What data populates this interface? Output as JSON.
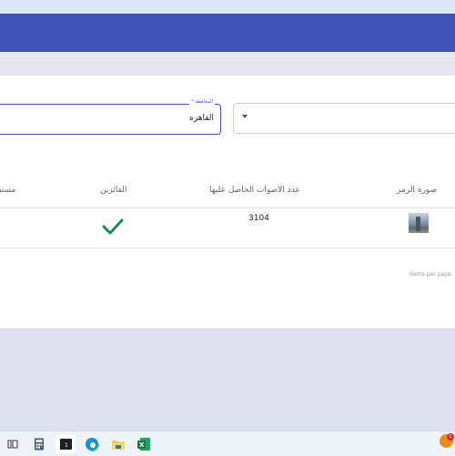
{
  "filters": {
    "select": {
      "value": ""
    },
    "governorate": {
      "label": "المحافظة",
      "required_mark": "*",
      "value": "القاهره"
    }
  },
  "table": {
    "columns": [
      "صورة الرمز",
      "عدد الاصوات الحاصل عليها",
      "الفائزين",
      "مستبعد"
    ],
    "rows": [
      {
        "thumbnail_icon": "landmark-tower-thumbnail",
        "votes": "3104",
        "winner_icon": "check-icon",
        "excluded": ""
      }
    ]
  },
  "paginator": {
    "items_per_page_label": "Items per page:"
  },
  "taskbar": {
    "icons": [
      "task-view-icon",
      "calculator-icon",
      "terminal-icon",
      "edge-browser-icon",
      "file-explorer-icon",
      "excel-icon"
    ],
    "notification": {
      "icon": "firefox-icon",
      "badge": "1"
    }
  },
  "colors": {
    "primary": "#3f51b5",
    "check": "#1b8a5a",
    "required": "#e53935"
  }
}
